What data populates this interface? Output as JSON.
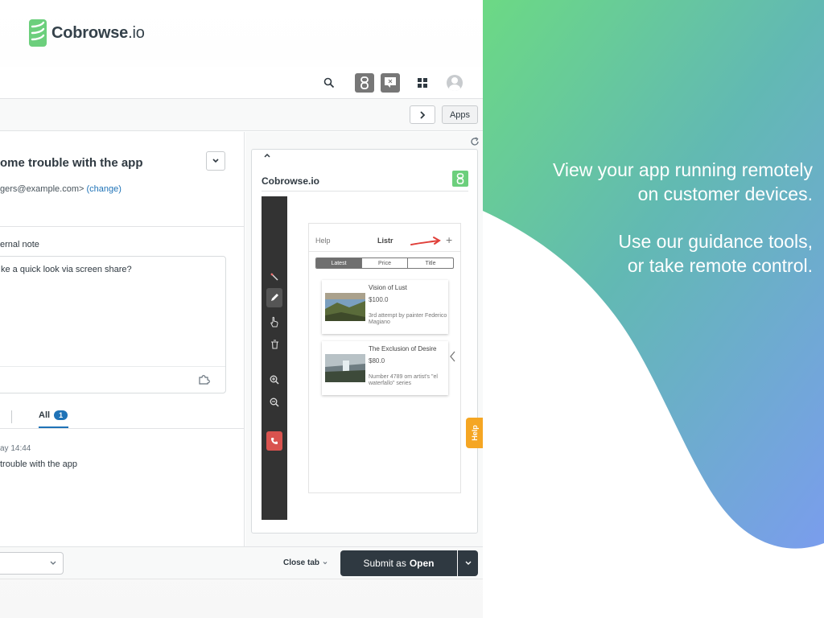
{
  "brand": {
    "name_main": "Cobrowse",
    "name_tld": ".io",
    "color": "#6ccf7c"
  },
  "tagline": {
    "line1a": "View your app running remotely",
    "line1b": "on customer devices.",
    "line2a": "Use our guidance tools,",
    "line2b": "or take remote control."
  },
  "topbar": {
    "icons": [
      "search-icon",
      "cobrowse-icon",
      "chat-icon",
      "grid-icon",
      "avatar"
    ]
  },
  "subbar": {
    "apps_label": "Apps"
  },
  "ticket": {
    "subject": "ome trouble with the app",
    "requester": "gers@example.com>",
    "change_label": "(change)",
    "note_label": "ernal note",
    "note_text": "ke a quick look via screen share?",
    "tab_all": "All",
    "tab_all_count": "1",
    "message_time": "ay 14:44",
    "message_text": "trouble with the app"
  },
  "cobrowse_panel": {
    "title": "Cobrowse.io",
    "device": {
      "help": "Help",
      "app_title": "Listr",
      "plus": "+",
      "segments": [
        "Latest",
        "Price",
        "Title"
      ],
      "selected_segment": "Latest",
      "items": [
        {
          "title": "Vision of Lust",
          "price": "$100.0",
          "desc": "3rd attempt by painter Federico Magiano"
        },
        {
          "title": "The Exclusion of Desire",
          "price": "$80.0",
          "desc": "Number 4789 om artist's \"el waterfallo\" series"
        }
      ]
    },
    "help_tab": "Help"
  },
  "bottombar": {
    "close_tab": "Close tab",
    "submit_prefix": "Submit as",
    "submit_status": "Open"
  },
  "colors": {
    "accent": "#1f73b7",
    "submit": "#2f3941",
    "help_tab": "#f5a623",
    "end_call": "#d9534f"
  }
}
